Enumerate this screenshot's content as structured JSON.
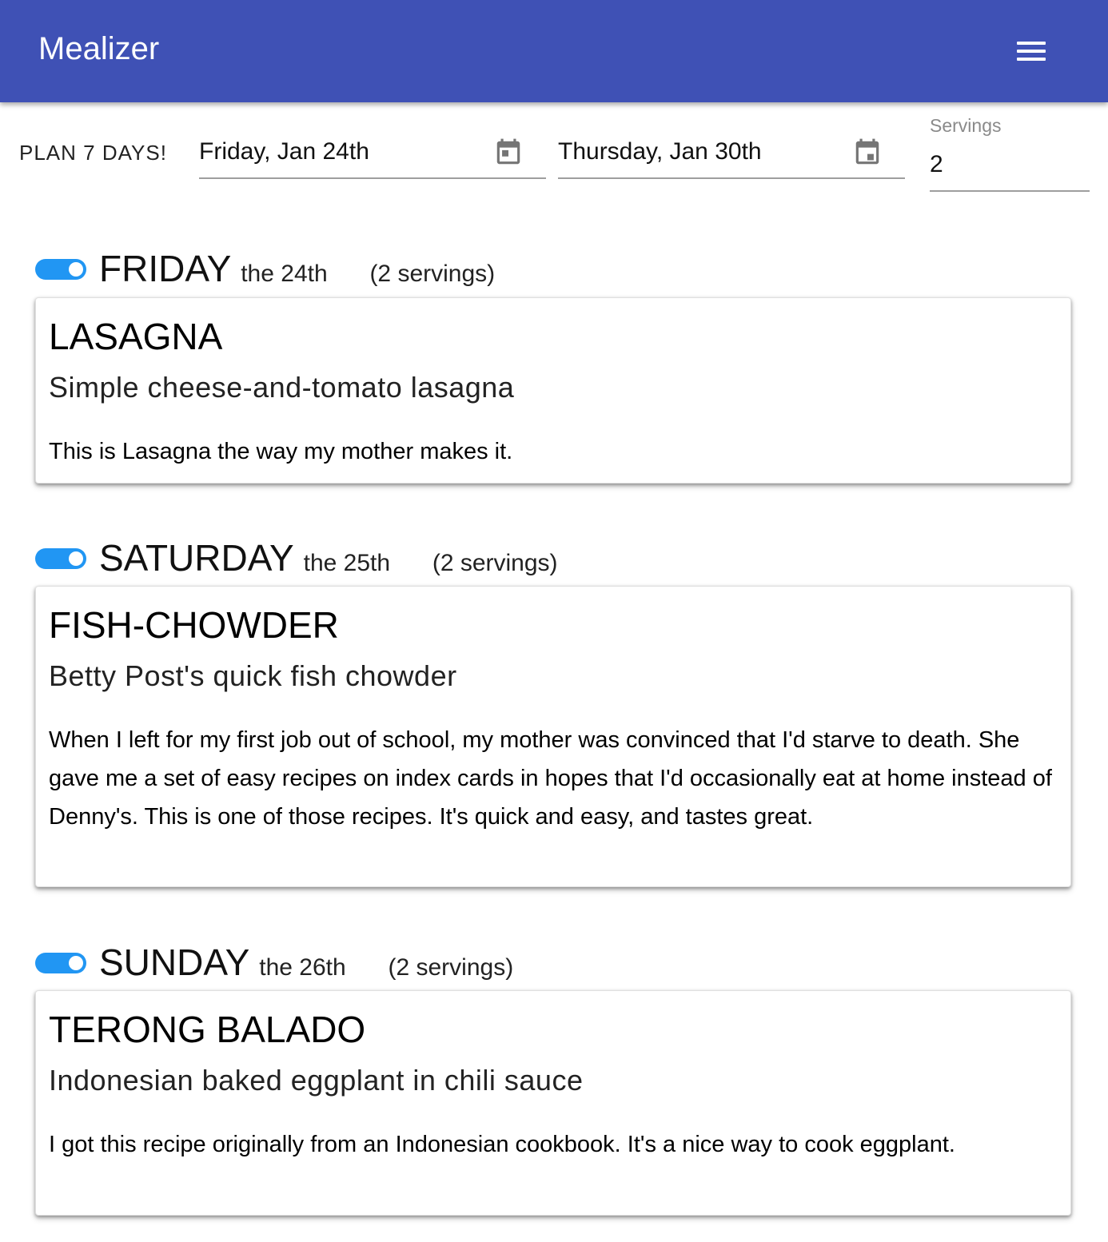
{
  "app": {
    "title": "Mealizer"
  },
  "toolbar": {
    "plan_button": "PLAN 7 DAYS!",
    "start_date": "Friday, Jan 24th",
    "end_date": "Thursday, Jan 30th",
    "servings_label": "Servings",
    "servings_value": "2"
  },
  "colors": {
    "appbar": "#3f51b5",
    "toggle_on": "#2196f3"
  },
  "days": [
    {
      "day": "FRIDAY",
      "date": "the 24th",
      "servings": "(2 servings)",
      "enabled": true,
      "recipe": {
        "title": "LASAGNA",
        "subtitle": "Simple cheese-and-tomato lasagna",
        "description": "This is Lasagna the way my mother makes it."
      }
    },
    {
      "day": "SATURDAY",
      "date": "the 25th",
      "servings": "(2 servings)",
      "enabled": true,
      "recipe": {
        "title": "FISH-CHOWDER",
        "subtitle": "Betty Post's quick fish chowder",
        "description": "When I left for my first job out of school, my mother was convinced that I'd starve to death. She gave me a set of easy recipes on index cards in hopes that I'd occasionally eat at home instead of Denny's. This is one of those recipes. It's quick and easy, and tastes great."
      }
    },
    {
      "day": "SUNDAY",
      "date": "the 26th",
      "servings": "(2 servings)",
      "enabled": true,
      "recipe": {
        "title": "TERONG BALADO",
        "subtitle": "Indonesian baked eggplant in chili sauce",
        "description": "I got this recipe originally from an Indonesian cookbook. It's a nice way to cook eggplant."
      }
    }
  ]
}
